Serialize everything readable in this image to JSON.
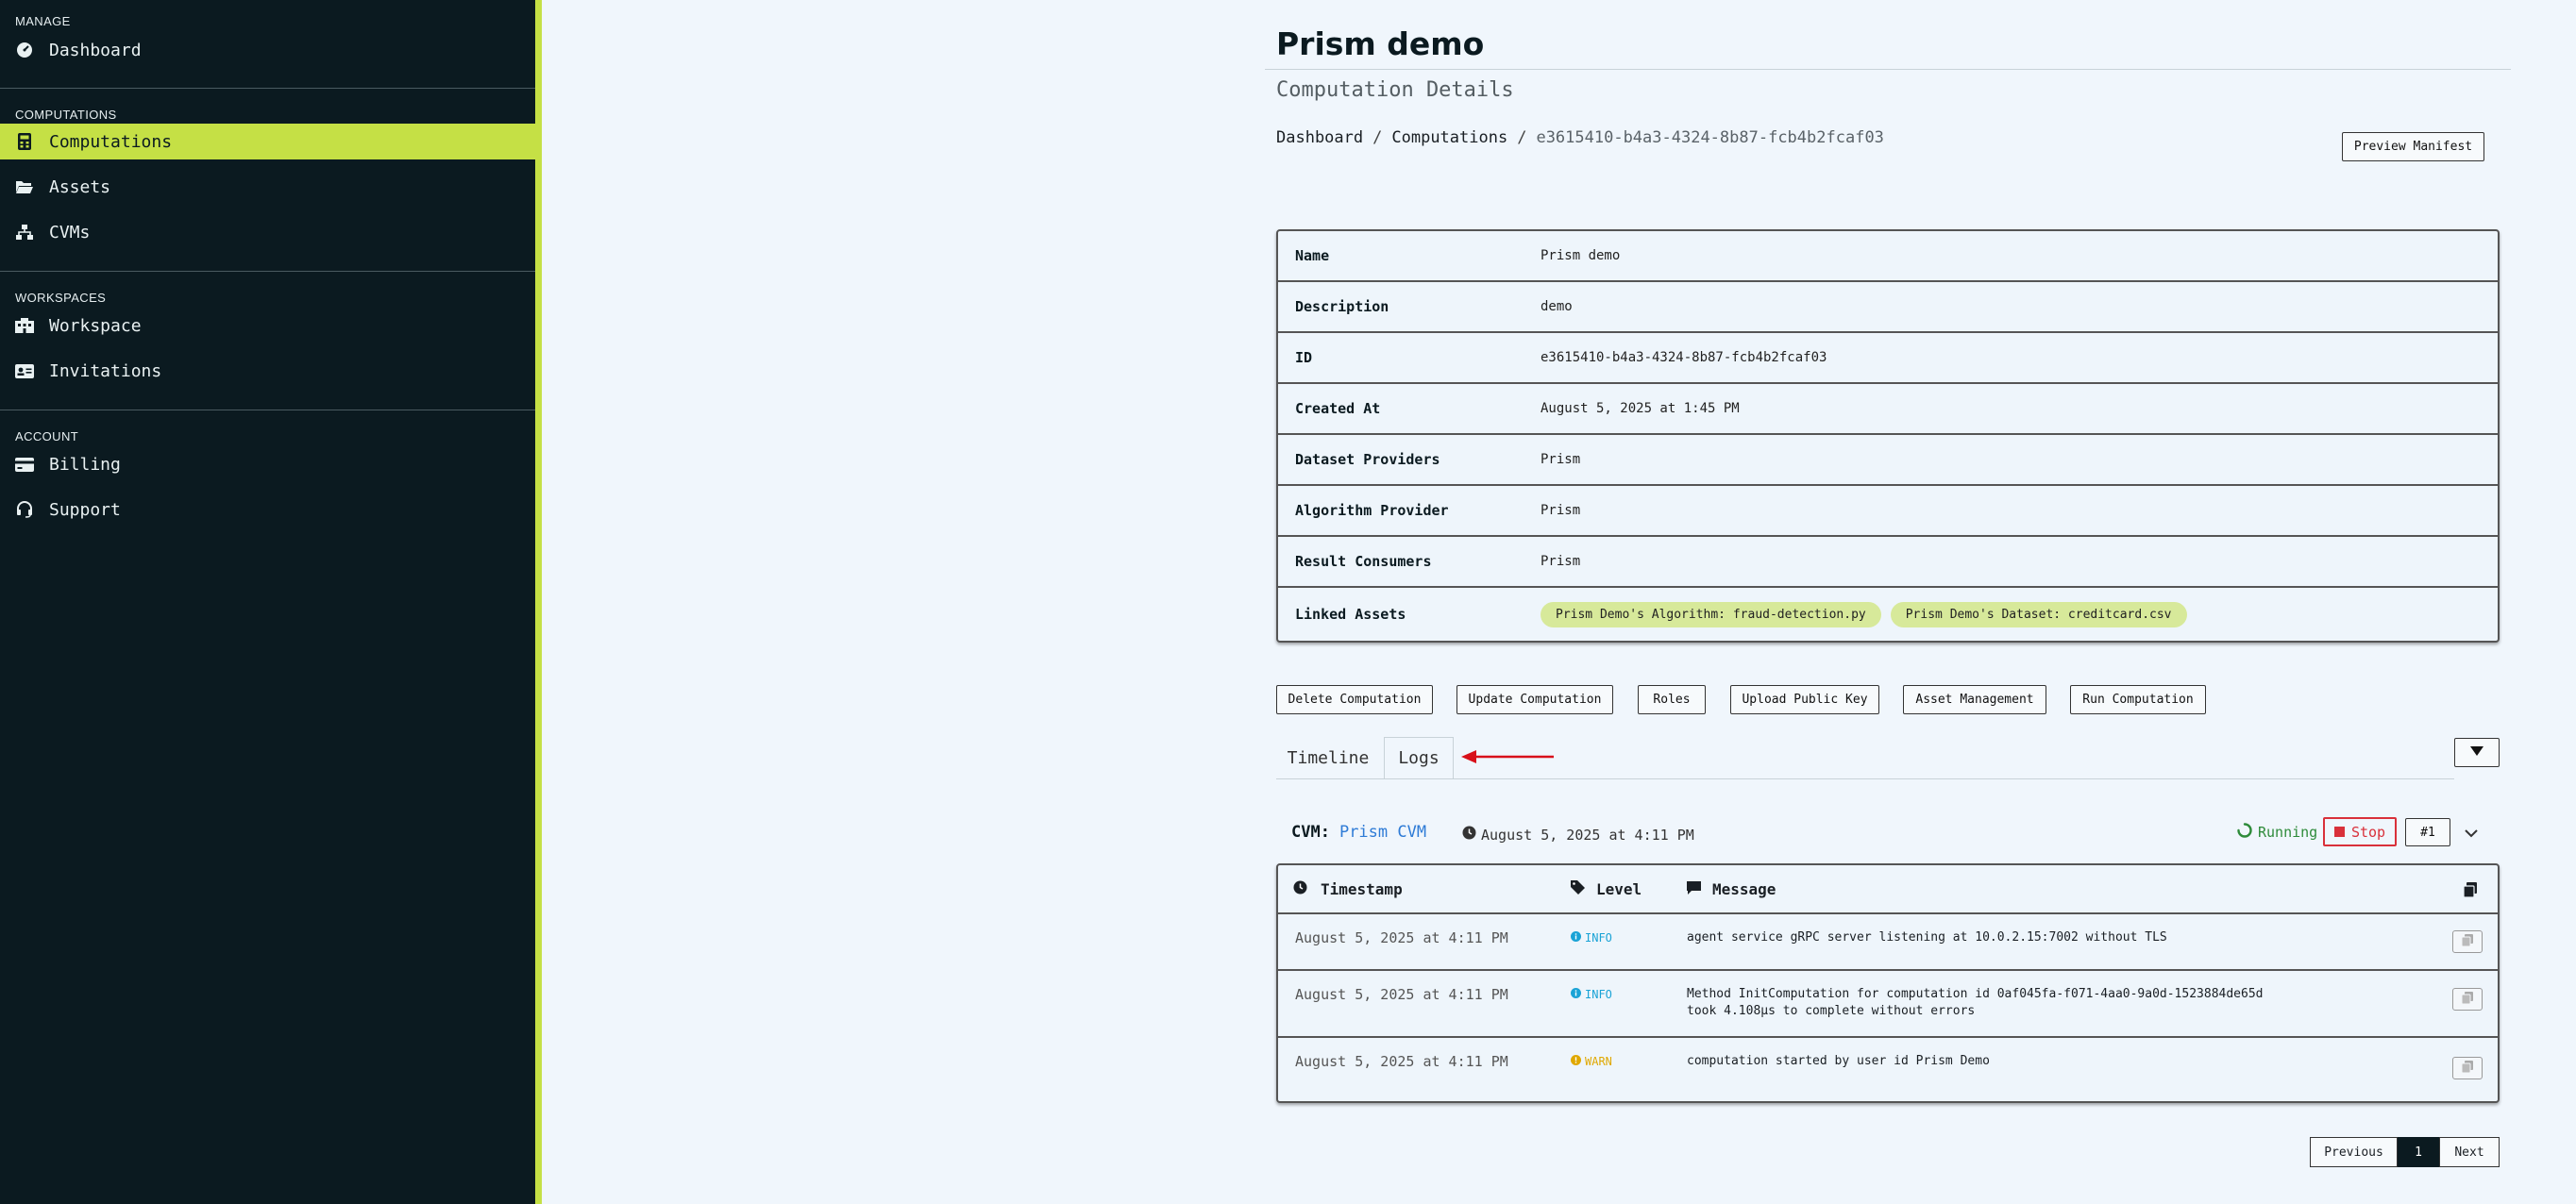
{
  "sidebar": {
    "sections": [
      {
        "title": "MANAGE",
        "items": [
          {
            "label": "Dashboard",
            "icon": "gauge-icon"
          }
        ]
      },
      {
        "title": "COMPUTATIONS",
        "items": [
          {
            "label": "Computations",
            "icon": "calculator-icon"
          },
          {
            "label": "Assets",
            "icon": "folder-open-icon"
          },
          {
            "label": "CVMs",
            "icon": "sitemap-icon"
          }
        ]
      },
      {
        "title": "WORKSPACES",
        "items": [
          {
            "label": "Workspace",
            "icon": "building-icon"
          },
          {
            "label": "Invitations",
            "icon": "id-card-icon"
          }
        ]
      },
      {
        "title": "ACCOUNT",
        "items": [
          {
            "label": "Billing",
            "icon": "credit-card-icon"
          },
          {
            "label": "Support",
            "icon": "headset-icon"
          }
        ]
      }
    ],
    "active_item": "Computations"
  },
  "header": {
    "title": "Prism demo",
    "subtitle": "Computation Details",
    "breadcrumb": [
      "Dashboard",
      "Computations",
      "e3615410-b4a3-4324-8b87-fcb4b2fcaf03"
    ],
    "preview_manifest_label": "Preview Manifest"
  },
  "details": [
    {
      "label": "Name",
      "value": "Prism demo"
    },
    {
      "label": "Description",
      "value": "demo"
    },
    {
      "label": "ID",
      "value": "e3615410-b4a3-4324-8b87-fcb4b2fcaf03"
    },
    {
      "label": "Created At",
      "value": "August 5, 2025 at 1:45 PM"
    },
    {
      "label": "Dataset Providers",
      "value": "Prism"
    },
    {
      "label": "Algorithm Provider",
      "value": "Prism"
    },
    {
      "label": "Result Consumers",
      "value": "Prism"
    },
    {
      "label": "Linked Assets",
      "chips": [
        "Prism Demo's Algorithm: fraud-detection.py",
        "Prism Demo's Dataset: creditcard.csv"
      ]
    }
  ],
  "actions": [
    "Delete Computation",
    "Update Computation",
    "Roles",
    "Upload Public Key",
    "Asset Management",
    "Run Computation"
  ],
  "tabs": [
    {
      "label": "Timeline",
      "active": false
    },
    {
      "label": "Logs",
      "active": true
    }
  ],
  "cvm": {
    "prefix": "CVM:",
    "name": "Prism CVM",
    "date": "August 5, 2025 at 4:11 PM",
    "status": "Running",
    "stop_label": "Stop",
    "run_number": "#1"
  },
  "logs": {
    "columns": [
      "Timestamp",
      "Level",
      "Message"
    ],
    "rows": [
      {
        "timestamp": "August 5, 2025 at 4:11 PM",
        "level": "INFO",
        "message": [
          "agent service gRPC server listening at 10.0.2.15:7002 without TLS"
        ]
      },
      {
        "timestamp": "August 5, 2025 at 4:11 PM",
        "level": "INFO",
        "message": [
          "Method InitComputation for computation id 0af045fa-f071-4aa0-9a0d-1523884de65d",
          "took 4.108µs to complete without errors"
        ]
      },
      {
        "timestamp": "August 5, 2025 at 4:11 PM",
        "level": "WARN",
        "message": [
          "computation started by user id Prism Demo"
        ]
      }
    ]
  },
  "pagination": {
    "previous": "Previous",
    "current": "1",
    "next": "Next"
  },
  "colors": {
    "accent": "#c5e045",
    "sidebar_bg": "#0b1a20",
    "info": "#1aa3d6",
    "warn": "#e0a800",
    "running": "#2e8b3a",
    "stop": "#d9303a",
    "link": "#2e7bd6"
  }
}
